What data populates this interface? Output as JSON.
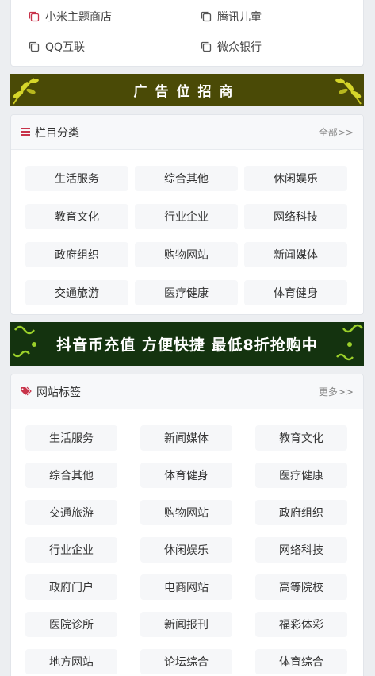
{
  "links": [
    {
      "label": "小米主题商店",
      "icon": "copy-icon",
      "color": "#c8334a"
    },
    {
      "label": "腾讯儿童",
      "icon": "copy-icon",
      "color": "#555555"
    },
    {
      "label": "QQ互联",
      "icon": "copy-icon",
      "color": "#555555"
    },
    {
      "label": "微众银行",
      "icon": "copy-icon",
      "color": "#555555"
    }
  ],
  "banner_ad": {
    "text": "广告位招商"
  },
  "banner_promo": {
    "text": "抖音币充值 方便快捷 最低8折抢购中"
  },
  "categories": {
    "title": "栏目分类",
    "more": "全部>>",
    "icon": "list-icon",
    "accent": "#c8334a",
    "items": [
      "生活服务",
      "综合其他",
      "休闲娱乐",
      "教育文化",
      "行业企业",
      "网络科技",
      "政府组织",
      "购物网站",
      "新闻媒体",
      "交通旅游",
      "医疗健康",
      "体育健身"
    ]
  },
  "tags": {
    "title": "网站标签",
    "more": "更多>>",
    "icon": "tags-icon",
    "accent": "#c8334a",
    "items": [
      "生活服务",
      "新闻媒体",
      "教育文化",
      "综合其他",
      "体育健身",
      "医疗健康",
      "交通旅游",
      "购物网站",
      "政府组织",
      "行业企业",
      "休闲娱乐",
      "网络科技",
      "政府门户",
      "电商网站",
      "高等院校",
      "医院诊所",
      "新闻报刊",
      "福彩体彩",
      "地方网站",
      "论坛综合",
      "体育综合"
    ]
  }
}
